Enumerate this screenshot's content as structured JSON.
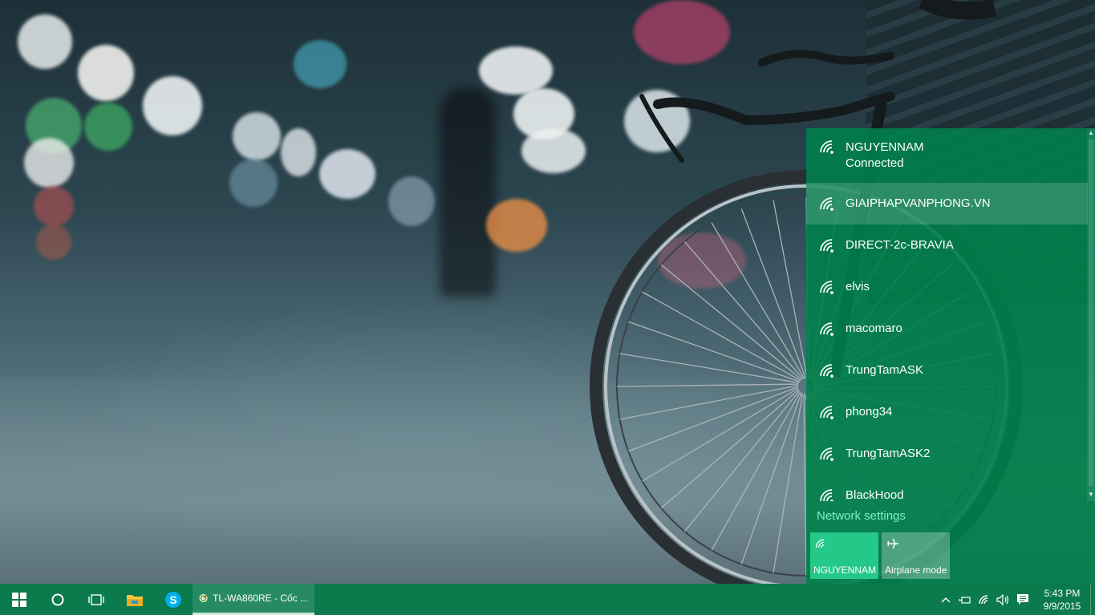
{
  "flyout": {
    "networks": [
      {
        "name": "NGUYENNAM",
        "status": "Connected"
      },
      {
        "name": "GIAIPHAPVANPHONG.VN"
      },
      {
        "name": "DIRECT-2c-BRAVIA"
      },
      {
        "name": "elvis"
      },
      {
        "name": "macomaro"
      },
      {
        "name": "TrungTamASK"
      },
      {
        "name": "phong34"
      },
      {
        "name": "TrungTamASK2"
      },
      {
        "name": "BlackHood"
      }
    ],
    "network_settings_label": "Network settings",
    "quick_actions": [
      {
        "label": "NGUYENNAM",
        "icon": "wifi-icon",
        "state": "on"
      },
      {
        "label": "Airplane mode",
        "icon": "airplane-icon",
        "state": "off"
      }
    ]
  },
  "taskbar": {
    "start_icon": "windows-logo-icon",
    "search_icon": "cortana-icon",
    "task_view_icon": "task-view-icon",
    "pinned": [
      {
        "icon": "file-explorer-icon"
      },
      {
        "icon": "skype-icon"
      }
    ],
    "active_app": {
      "label": "TL-WA860RE - Cốc ...",
      "icon": "coc-coc-browser-icon"
    },
    "tray_icons": [
      "chevron-up-icon",
      "power-icon",
      "wifi-icon",
      "volume-icon",
      "action-center-icon"
    ],
    "clock": {
      "time": "5:43 PM",
      "date": "9/9/2015"
    }
  },
  "colors": {
    "accent": "#00804B",
    "taskbar": "#0B7A4D",
    "tile_on": "#24C98A",
    "link": "#7FF0C8"
  }
}
